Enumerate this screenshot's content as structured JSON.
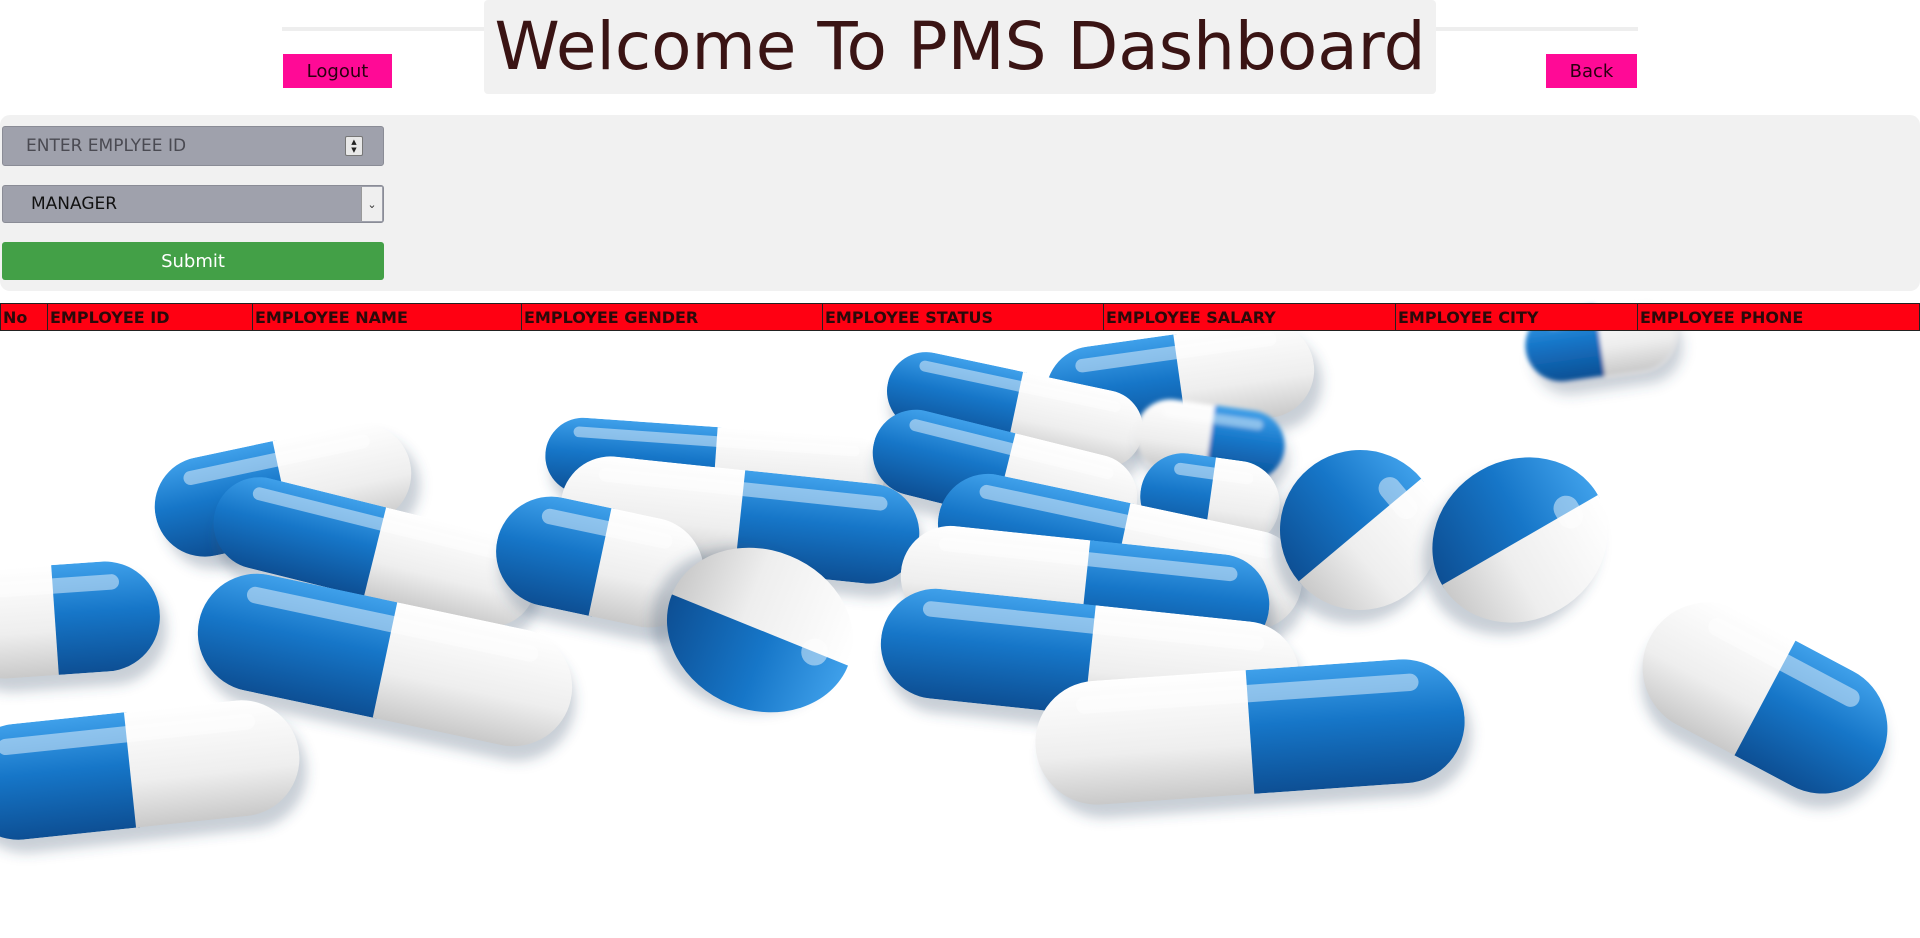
{
  "header": {
    "title": "Welcome To PMS Dashboard",
    "logout_label": "Logout",
    "back_label": "Back"
  },
  "form": {
    "employee_id_placeholder": "ENTER EMPLYEE ID",
    "role_selected": "MANAGER",
    "submit_label": "Submit"
  },
  "table": {
    "columns": [
      "No",
      "EMPLOYEE ID",
      "EMPLOYEE NAME",
      "EMPLOYEE GENDER",
      "EMPLOYEE STATUS",
      "EMPLOYEE SALARY",
      "EMPLOYEE CITY",
      "EMPLOYEE PHONE"
    ],
    "rows": []
  },
  "background": {
    "image": "blue-white-capsules"
  },
  "colors": {
    "nav_button": "#ff0a96",
    "submit_button": "#43a047",
    "table_header": "#ff0012",
    "pill_blue": "#1e7fd0",
    "pill_white": "#f4f4f4",
    "title_text": "#3a1414"
  }
}
